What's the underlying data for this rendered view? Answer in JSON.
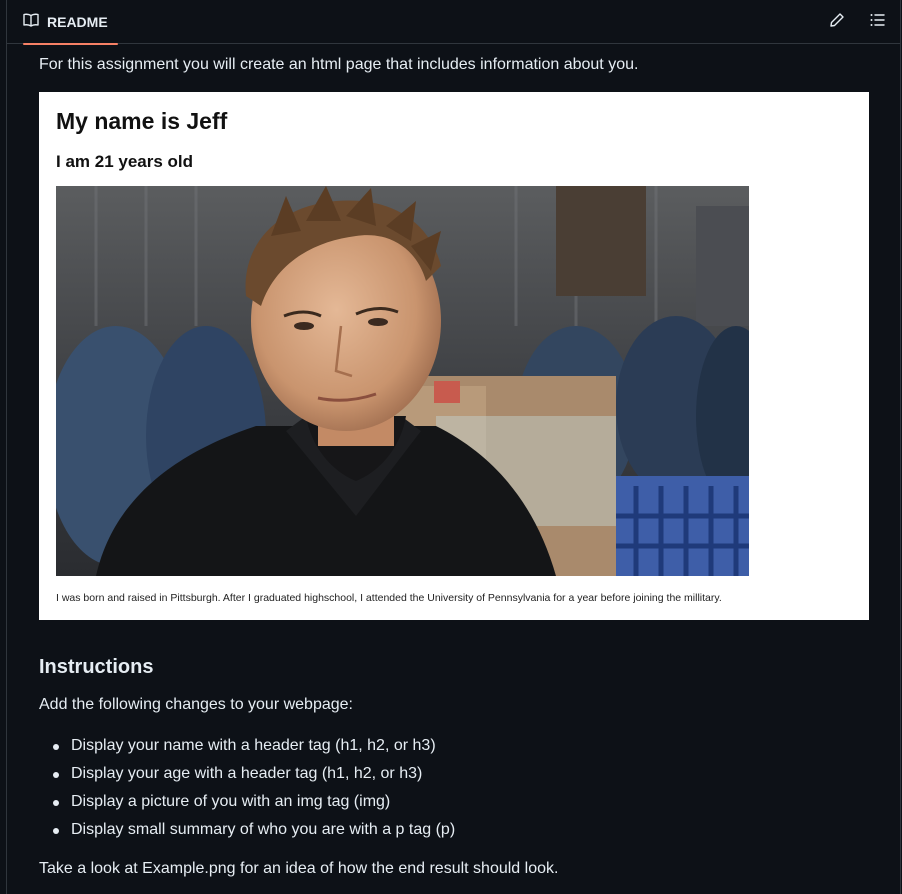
{
  "header": {
    "tab_label": "README",
    "tab_icon": "book-icon",
    "edit_icon": "pencil-icon",
    "outline_icon": "list-unordered-icon",
    "accent_color": "#f78166"
  },
  "readme": {
    "intro": "For this assignment you will create an html page that includes information about you.",
    "example": {
      "heading": "My name is Jeff",
      "subheading": "I am 21 years old",
      "photo_alt": "Photo of a man in a black shirt in a warehouse",
      "summary": "I was born and raised in Pittsburgh. After I graduated highschool, I attended the University of Pennsylvania for a year before joining the millitary."
    },
    "instructions_heading": "Instructions",
    "instructions_lead": "Add the following changes to your webpage:",
    "instructions": [
      "Display your name with a header tag (h1, h2, or h3)",
      "Display your age with a header tag (h1, h2, or h3)",
      "Display a picture of you with an img tag (img)",
      "Display small summary of who you are with a p tag (p)"
    ],
    "outro": "Take a look at Example.png for an idea of how the end result should look."
  }
}
